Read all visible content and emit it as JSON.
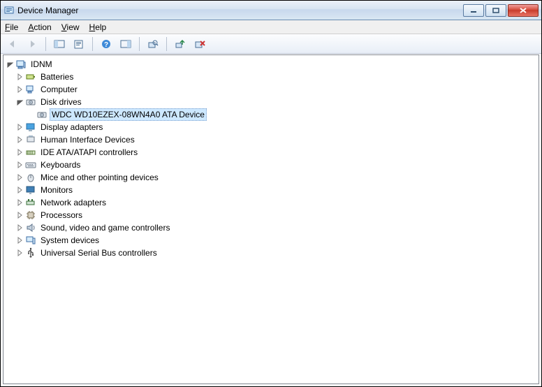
{
  "window": {
    "title": "Device Manager"
  },
  "menu": {
    "file": "File",
    "action": "Action",
    "view": "View",
    "help": "Help"
  },
  "tree": {
    "root": {
      "label": "IDNM",
      "expanded": true
    },
    "categories": [
      {
        "label": "Batteries",
        "icon": "battery",
        "expanded": false,
        "children": []
      },
      {
        "label": "Computer",
        "icon": "computer",
        "expanded": false,
        "children": []
      },
      {
        "label": "Disk drives",
        "icon": "disk",
        "expanded": true,
        "children": [
          {
            "label": "WDC WD10EZEX-08WN4A0 ATA Device",
            "icon": "disk",
            "selected": true
          }
        ]
      },
      {
        "label": "Display adapters",
        "icon": "display",
        "expanded": false,
        "children": []
      },
      {
        "label": "Human Interface Devices",
        "icon": "hid",
        "expanded": false,
        "children": []
      },
      {
        "label": "IDE ATA/ATAPI controllers",
        "icon": "ide",
        "expanded": false,
        "children": []
      },
      {
        "label": "Keyboards",
        "icon": "keyboard",
        "expanded": false,
        "children": []
      },
      {
        "label": "Mice and other pointing devices",
        "icon": "mouse",
        "expanded": false,
        "children": []
      },
      {
        "label": "Monitors",
        "icon": "monitor",
        "expanded": false,
        "children": []
      },
      {
        "label": "Network adapters",
        "icon": "network",
        "expanded": false,
        "children": []
      },
      {
        "label": "Processors",
        "icon": "processor",
        "expanded": false,
        "children": []
      },
      {
        "label": "Sound, video and game controllers",
        "icon": "sound",
        "expanded": false,
        "children": []
      },
      {
        "label": "System devices",
        "icon": "system",
        "expanded": false,
        "children": []
      },
      {
        "label": "Universal Serial Bus controllers",
        "icon": "usb",
        "expanded": false,
        "children": []
      }
    ]
  }
}
